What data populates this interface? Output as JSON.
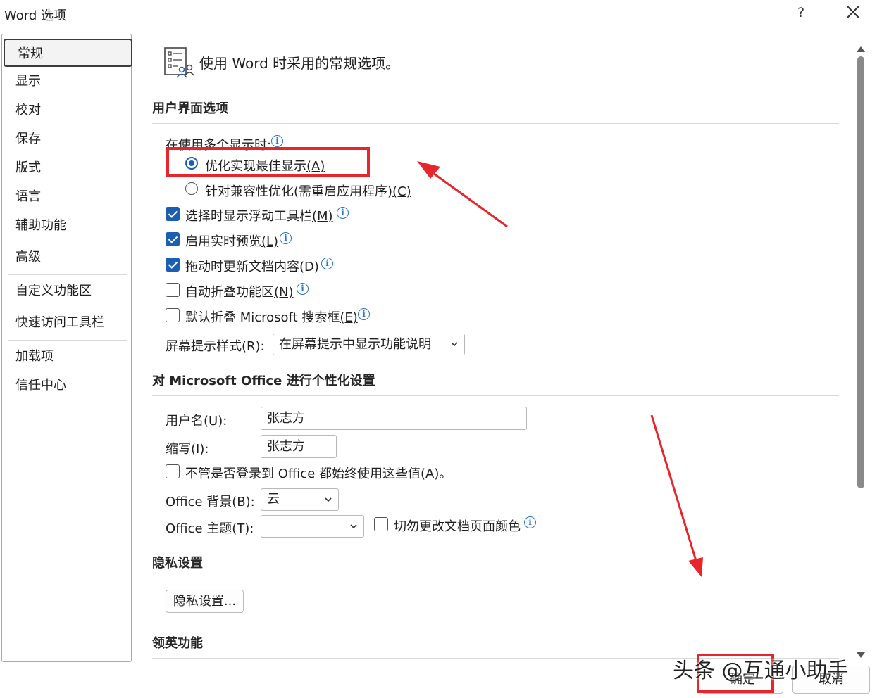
{
  "window": {
    "title": "Word 选项",
    "help_label": "?"
  },
  "sidebar": {
    "items": [
      {
        "label": "常规"
      },
      {
        "label": "显示"
      },
      {
        "label": "校对"
      },
      {
        "label": "保存"
      },
      {
        "label": "版式"
      },
      {
        "label": "语言"
      },
      {
        "label": "辅助功能"
      },
      {
        "label": "高级"
      },
      {
        "label": "自定义功能区"
      },
      {
        "label": "快速访问工具栏"
      },
      {
        "label": "加载项"
      },
      {
        "label": "信任中心"
      }
    ],
    "selected": "常规"
  },
  "main": {
    "heading": "使用 Word 时采用的常规选项。",
    "ui_options": {
      "title": "用户界面选项",
      "multi_display_label": "在使用多个显示时:",
      "radio_best": {
        "text": "优化实现最佳显示",
        "key": "(A)",
        "selected": true
      },
      "radio_compat": {
        "text": "针对兼容性优化(需重启应用程序)",
        "key": "(C)",
        "selected": false
      },
      "checkboxes": [
        {
          "text": "选择时显示浮动工具栏",
          "key": "(M)",
          "checked": true
        },
        {
          "text": "启用实时预览",
          "key": "(L)",
          "checked": true
        },
        {
          "text": "拖动时更新文档内容",
          "key": "(D)",
          "checked": true
        },
        {
          "text": "自动折叠功能区",
          "key": "(N)",
          "checked": false
        },
        {
          "text": "默认折叠 Microsoft 搜索框",
          "key": "(E)",
          "checked": false
        }
      ],
      "screentip_label": "屏幕提示样式(R):",
      "screentip_value": "在屏幕提示中显示功能说明"
    },
    "personalize": {
      "title": "对 Microsoft Office 进行个性化设置",
      "username_label": "用户名(U):",
      "username_value": "张志方",
      "initials_label": "缩写(I):",
      "initials_value": "张志方",
      "always_use_label": "不管是否登录到 Office 都始终使用这些值(A)。",
      "always_use_checked": false,
      "background_label": "Office 背景(B):",
      "background_value": "云",
      "theme_label": "Office 主题(T):",
      "theme_value": "",
      "no_change_color_label": "切勿更改文档页面颜色",
      "no_change_color_checked": false
    },
    "privacy": {
      "title": "隐私设置",
      "button": "隐私设置..."
    },
    "linkedin": {
      "title": "领英功能"
    }
  },
  "footer": {
    "ok": "确定",
    "cancel": "取消"
  },
  "watermark": "头条 @互通小助手",
  "colors": {
    "accent": "#1b5fb3",
    "annotation": "#e8252b",
    "info": "#2b74c9"
  }
}
